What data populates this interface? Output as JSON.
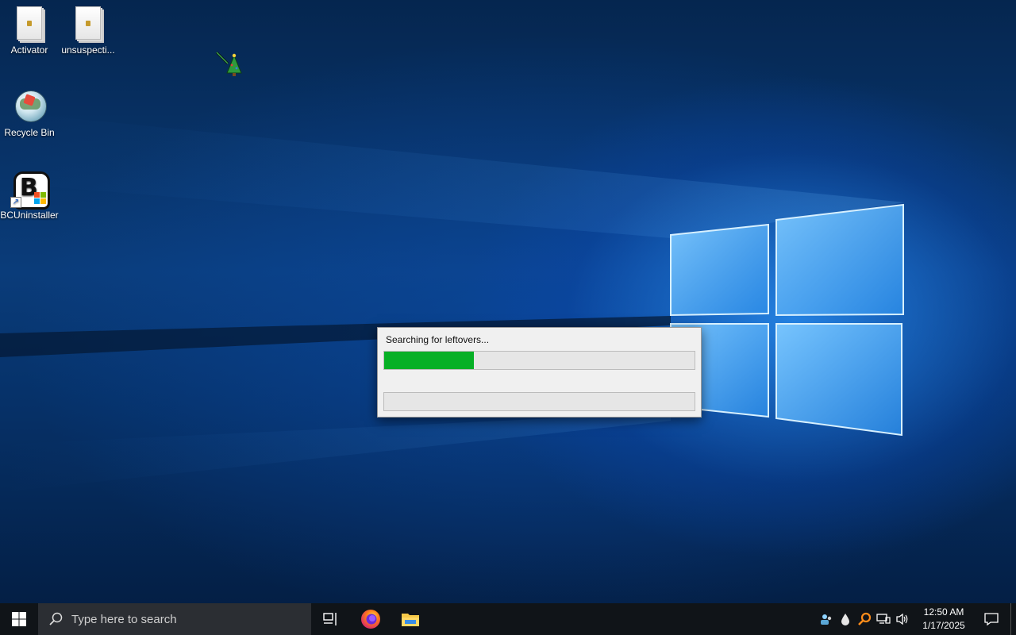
{
  "desktop": {
    "icons": [
      {
        "label": "Activator"
      },
      {
        "label": "unsuspecti..."
      },
      {
        "label": "Recycle Bin"
      },
      {
        "label": "BCUninstaller"
      }
    ]
  },
  "dialog": {
    "status_text": "Searching for leftovers...",
    "progress_primary": 0.29,
    "progress_secondary": 0.0,
    "fill_color": "#06b025"
  },
  "taskbar": {
    "search_placeholder": "Type here to search",
    "pinned": [
      {
        "icon": "task-view-icon"
      },
      {
        "icon": "firefox-icon"
      },
      {
        "icon": "file-explorer-icon"
      }
    ],
    "tray_icons": [
      "people-icon",
      "drop-icon",
      "search-tool-icon",
      "network-icon",
      "volume-icon"
    ],
    "clock_time": "12:50 AM",
    "clock_date": "1/17/2025"
  },
  "colors": {
    "accent": "#0078d7",
    "taskbar_bg": "#101418"
  }
}
